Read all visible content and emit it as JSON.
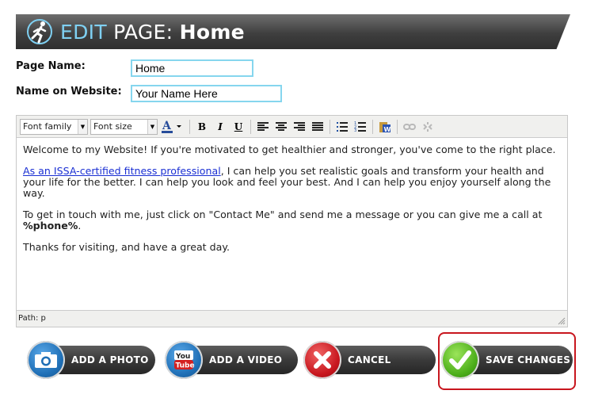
{
  "header": {
    "edit": "EDIT",
    "page": "PAGE:",
    "name": "Home",
    "logo_icon": "runner-icon"
  },
  "form": {
    "page_name_label": "Page Name:",
    "page_name_value": "Home",
    "website_name_label": "Name on Website:",
    "website_name_value": "Your Name Here"
  },
  "toolbar": {
    "font_family": "Font family",
    "font_size": "Font size",
    "bold": "B",
    "italic": "I",
    "underline": "U",
    "icons": [
      "text-color-icon",
      "bold-icon",
      "italic-icon",
      "underline-icon",
      "align-left-icon",
      "align-center-icon",
      "align-right-icon",
      "align-justify-icon",
      "bullet-list-icon",
      "numbered-list-icon",
      "paste-word-icon",
      "link-icon",
      "unlink-icon"
    ]
  },
  "content": {
    "p1": "Welcome to my Website! If you're motivated to get healthier and stronger, you've come to the right place.",
    "p2_link": "As an ISSA-certified fitness professional",
    "p2_rest": ", I can help you set realistic goals and transform your health and your life for the better. I can help you look and feel your best. And I can help you enjoy yourself along the way.",
    "p3_text": "To get in touch with me, just click on \"Contact Me\" and send me a message or you can give me a call at ",
    "p3_phone": "%phone%",
    "p3_end": ".",
    "p4": "Thanks for visiting, and have a great day."
  },
  "pathbar": {
    "text": "Path: p"
  },
  "buttons": {
    "add_photo": "ADD A PHOTO",
    "add_video": "ADD A VIDEO",
    "cancel": "CANCEL",
    "save": "SAVE CHANGES"
  },
  "colors": {
    "accent": "#7fd0f2",
    "field_border": "#86d6ee",
    "link": "#1a2fd3",
    "cancel_red": "#c8161e",
    "save_green": "#4cae1a",
    "photo_blue": "#1f6fb6"
  }
}
